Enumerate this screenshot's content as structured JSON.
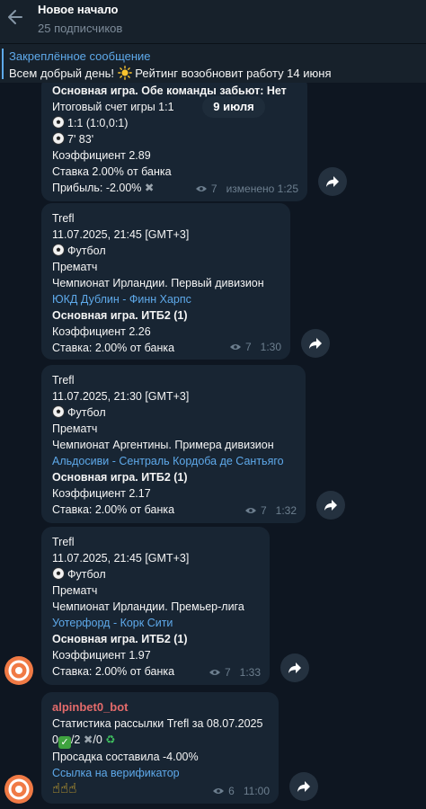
{
  "header": {
    "title": "Новое начало",
    "subscribers": "25 подписчиков"
  },
  "pinned": {
    "title": "Закреплённое сообщение",
    "text_before": "Всем добрый день!",
    "text_after": "Рейтинг возобновит работу 14 июня"
  },
  "date_pill": "9 июля",
  "messages": [
    {
      "lines": {
        "main": "Основная игра. Обе команды забьют: Нет",
        "final": "Итоговый счет игры 1:1",
        "score": "1:1 (1:0,0:1)",
        "goals": "7' 83'",
        "coef": "Коэффициент 2.89",
        "stake": "Ставка 2.00% от банка",
        "profit": "Прибыль: -2.00%"
      },
      "views": "7",
      "time": "изменено 1:25"
    },
    {
      "lines": {
        "source": "Trefl",
        "datetime": "11.07.2025, 21:45 [GMT+3]",
        "sport": "Футбол",
        "mode": "Прематч",
        "league": "Чемпионат Ирландии. Первый дивизион",
        "match": "ЮКД Дублин - Финн Харпс",
        "bet": "Основная игра. ИТБ2 (1)",
        "coef": "Коэффициент 2.26",
        "stake": "Ставка: 2.00% от банка"
      },
      "views": "7",
      "time": "1:30"
    },
    {
      "lines": {
        "source": "Trefl",
        "datetime": "11.07.2025, 21:30 [GMT+3]",
        "sport": "Футбол",
        "mode": "Прематч",
        "league": "Чемпионат Аргентины. Примера дивизион",
        "match": "Альдосиви - Сентраль Кордоба де Сантьяго",
        "bet": "Основная игра. ИТБ2 (1)",
        "coef": "Коэффициент 2.17",
        "stake": "Ставка: 2.00% от банка"
      },
      "views": "7",
      "time": "1:32"
    },
    {
      "lines": {
        "source": "Trefl",
        "datetime": "11.07.2025, 21:45 [GMT+3]",
        "sport": "Футбол",
        "mode": "Прематч",
        "league": "Чемпионат Ирландии. Премьер-лига",
        "match": "Уотерфорд - Корк Сити",
        "bet": "Основная игра. ИТБ2 (1)",
        "coef": "Коэффициент 1.97",
        "stake": "Ставка: 2.00% от банка"
      },
      "views": "7",
      "time": "1:33"
    },
    {
      "lines": {
        "author": "alpinbet0_bot",
        "stats": "Статистика рассылки Trefl за 08.07.2025",
        "win_count": "0",
        "loss_count": "/2",
        "refund_count": "/0",
        "drawdown": "Просадка составила -4.00%",
        "verify_link": "Ссылка на верификатор",
        "fingers": "☝☝☝"
      },
      "views": "6",
      "time": "11:00"
    }
  ],
  "icons": {
    "back": "back-arrow-icon",
    "forward": "forward-arrow-icon",
    "views": "eye-icon",
    "ball": "soccer-ball-icon",
    "sun": "sun-icon",
    "avatar": "channel-avatar-icon"
  },
  "colors": {
    "background": "#0e1621",
    "bubble": "#182533",
    "link": "#5ea9ea",
    "author": "#e46b6b"
  }
}
